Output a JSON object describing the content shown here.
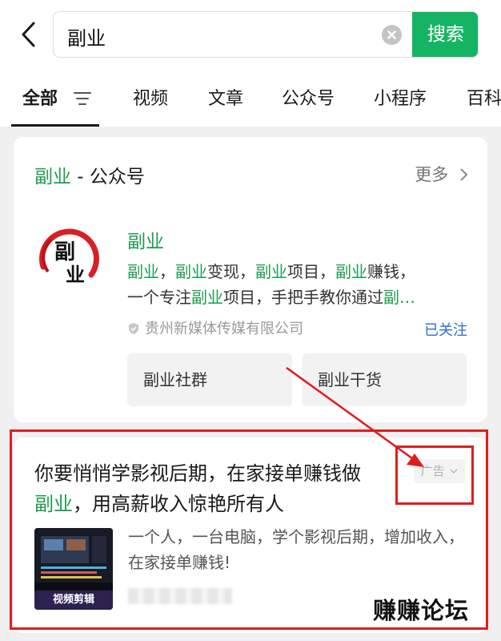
{
  "search": {
    "query": "副业",
    "button_label": "搜索"
  },
  "tabs": [
    "全部",
    "视频",
    "文章",
    "公众号",
    "小程序",
    "百科"
  ],
  "account_section": {
    "keyword": "副业",
    "title_suffix": " - 公众号",
    "more_label": "更多",
    "account": {
      "name": "副业",
      "logo_text": "副业",
      "description_parts": [
        {
          "text": "副业",
          "highlight": true
        },
        {
          "text": "，",
          "highlight": false
        },
        {
          "text": "副业",
          "highlight": true
        },
        {
          "text": "变现，",
          "highlight": false
        },
        {
          "text": "副业",
          "highlight": true
        },
        {
          "text": "项目，",
          "highlight": false
        },
        {
          "text": "副业",
          "highlight": true
        },
        {
          "text": "赚钱，",
          "highlight": false
        }
      ],
      "description_line2": [
        {
          "text": "一个专注",
          "highlight": false
        },
        {
          "text": "副业",
          "highlight": true
        },
        {
          "text": "项目，手把手教你通过",
          "highlight": false
        },
        {
          "text": "副…",
          "highlight": true
        }
      ],
      "company": "贵州新媒体传媒有限公司",
      "follow_status": "已关注",
      "menus": [
        "副业社群",
        "副业干货"
      ]
    }
  },
  "ad": {
    "title_line1": "你要悄悄学影视后期，在家接单赚钱做",
    "title_keyword": "副业",
    "title_line2_rest": "，用高薪收入惊艳所有人",
    "badge": "广告",
    "thumb_caption": "视频剪辑",
    "description": "一个人，一台电脑，学个影视后期，增加收入，在家接单赚钱!"
  },
  "watermark": "赚赚论坛",
  "colors": {
    "accent_green": "#15b464",
    "keyword_green": "#1f9b52",
    "annotation_red": "#e01d1d",
    "link_blue": "#2a6bd6"
  }
}
